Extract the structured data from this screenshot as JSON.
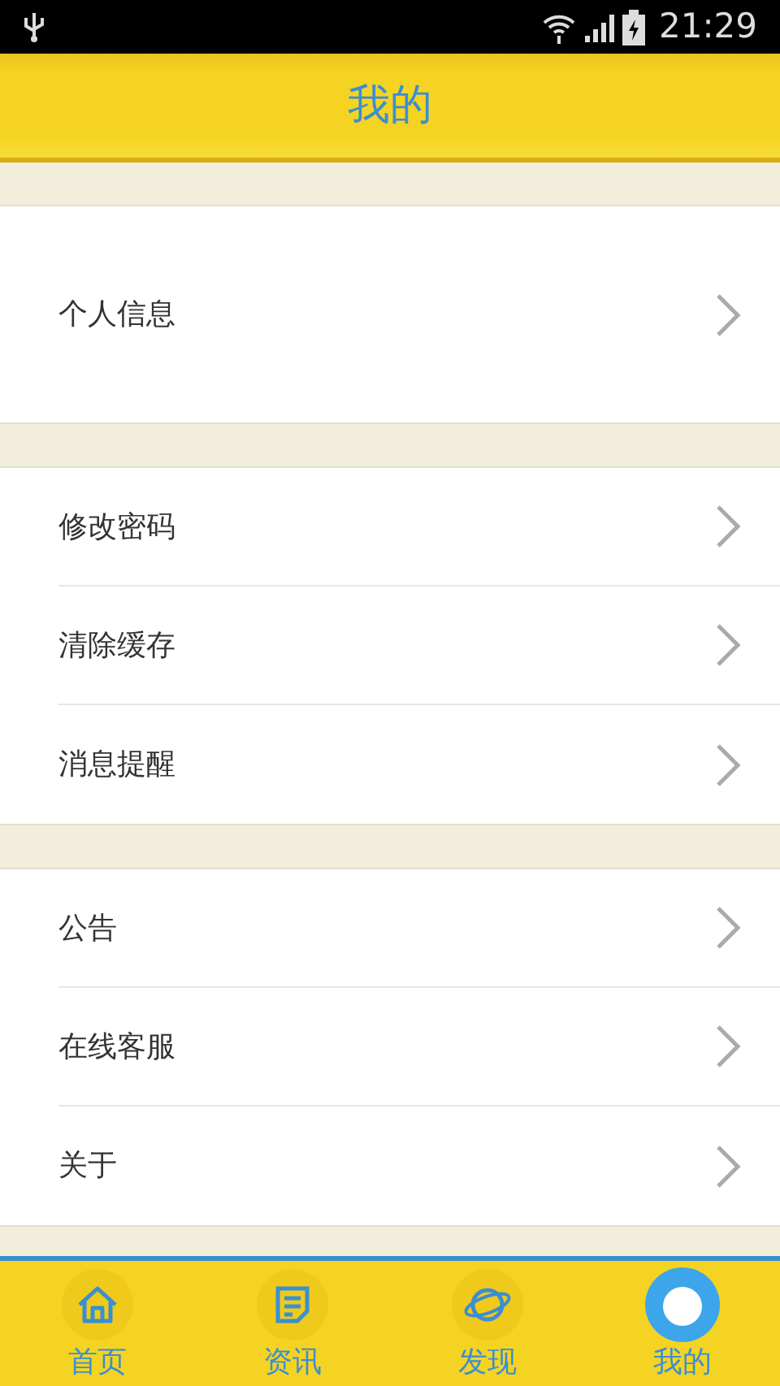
{
  "status_bar": {
    "time": "21:29"
  },
  "header": {
    "title": "我的"
  },
  "groups": [
    {
      "items": [
        {
          "label": "个人信息"
        }
      ]
    },
    {
      "items": [
        {
          "label": "修改密码"
        },
        {
          "label": "清除缓存"
        },
        {
          "label": "消息提醒"
        }
      ]
    },
    {
      "items": [
        {
          "label": "公告"
        },
        {
          "label": "在线客服"
        },
        {
          "label": "关于"
        }
      ]
    }
  ],
  "tabs": [
    {
      "label": "首页",
      "kind": "home",
      "selected": false
    },
    {
      "label": "资讯",
      "kind": "news",
      "selected": false
    },
    {
      "label": "发现",
      "kind": "discover",
      "selected": false
    },
    {
      "label": "我的",
      "kind": "me",
      "selected": true
    }
  ]
}
